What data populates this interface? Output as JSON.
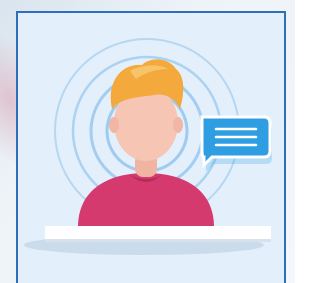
{
  "scene": {
    "subject": "person-avatar",
    "accessory": "chat-bubble-icon"
  },
  "colors": {
    "card_border": "#2f6fb8",
    "card_background": "#e3f0fb",
    "ring_color": "#8fc2ec",
    "hair": "#f3a93c",
    "skin": "#f7c5b4",
    "shirt": "#d43a6e",
    "bubble": "#2f9de2",
    "shelf": "#ffffff"
  }
}
